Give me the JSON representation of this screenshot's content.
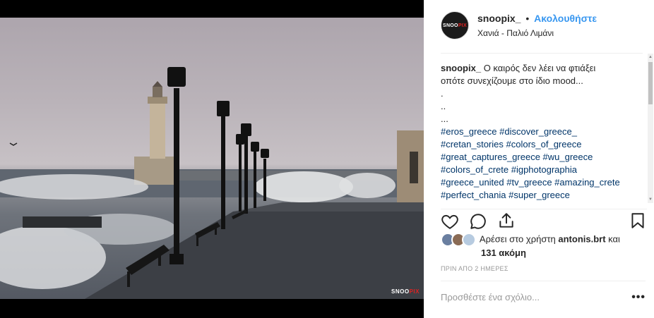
{
  "photo": {
    "watermark_main": "SNOO",
    "watermark_accent": "PIX"
  },
  "header": {
    "avatar_text": "SNOO",
    "avatar_accent": "PIX",
    "username": "snoopix_",
    "separator": "•",
    "follow_label": "Ακολουθήστε",
    "location": "Χανιά - Παλιό Λιμάνι"
  },
  "caption": {
    "username": "snoopix_",
    "lines": [
      "Ο καιρός δεν λέει να φτιάξει",
      "οπότε συνεχίζουμε στο ίδιο mood...",
      ".",
      "..",
      "..."
    ],
    "hashtags": [
      "#eros_greece #discover_greece_",
      "#cretan_stories #colors_of_greece",
      "#great_captures_greece #wu_greece",
      "#colors_of_crete #igphotographia",
      "#greece_united #tv_greece #amazing_crete",
      "#perfect_chania #super_greece"
    ]
  },
  "likes": {
    "prefix": "Αρέσει στο χρήστη",
    "user": "antonis.brt",
    "conjunction": "και",
    "others": "131 ακόμη"
  },
  "timestamp": "ΠΡΙΝ ΑΠΟ 2 ΗΜΕΡΕΣ",
  "comment": {
    "placeholder": "Προσθέστε ένα σχόλιο...",
    "more_label": "•••"
  },
  "icons": {
    "like": "heart-icon",
    "comment": "comment-icon",
    "share": "share-icon",
    "save": "bookmark-icon"
  }
}
